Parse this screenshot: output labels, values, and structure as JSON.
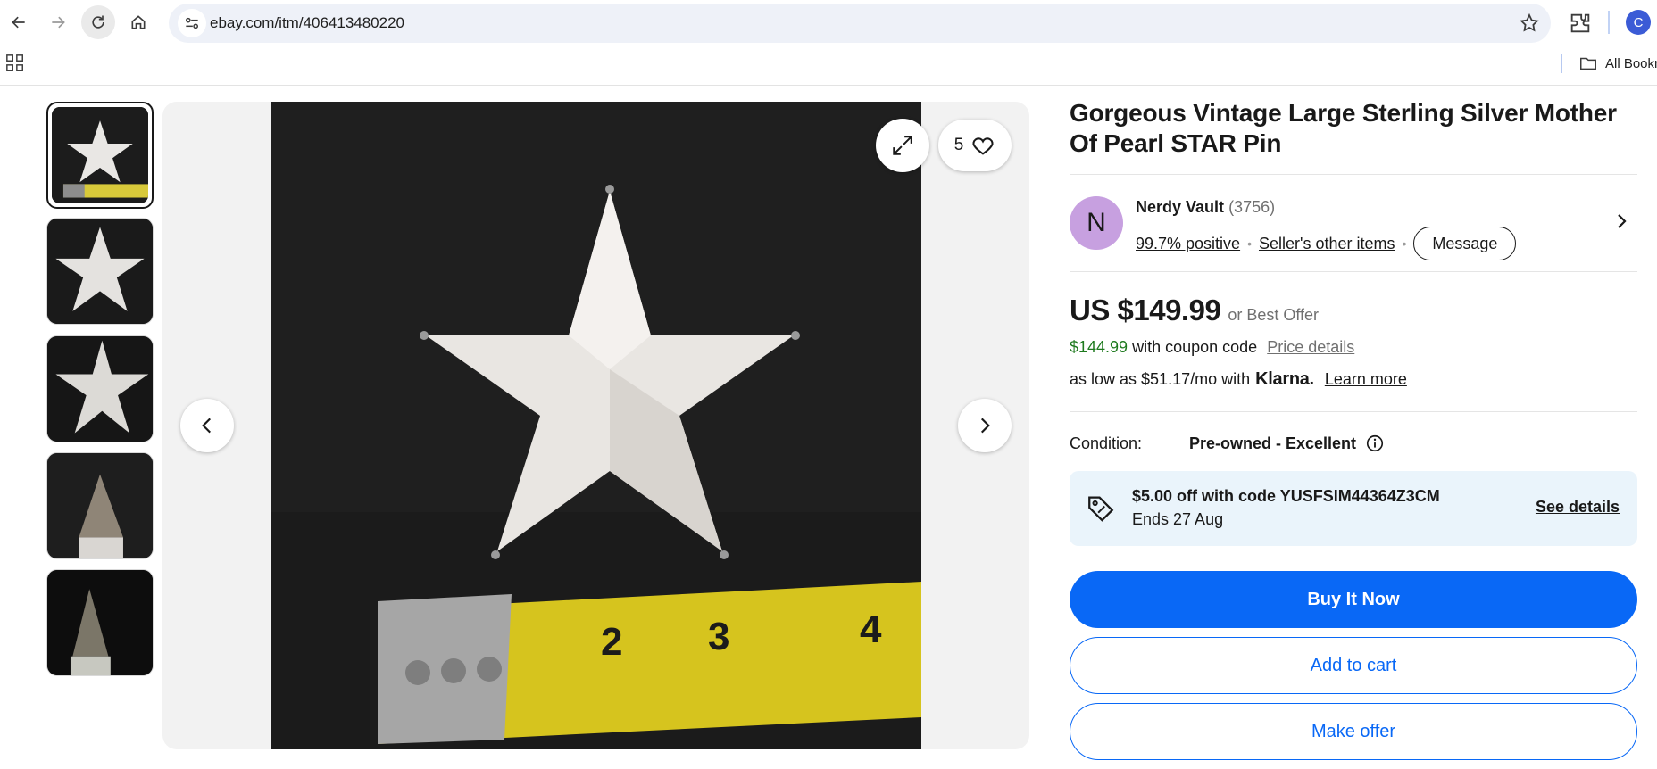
{
  "browser": {
    "url": "ebay.com/itm/406413480220",
    "bookmarks_label": "All Bookmarks",
    "profile_initial": "C"
  },
  "gallery": {
    "thumbnails": [
      "Star front with tape",
      "Star front",
      "Star angle",
      "Star point close-up",
      "Star point detail"
    ],
    "watch_count": "5"
  },
  "listing": {
    "title": "Gorgeous Vintage Large Sterling Silver Mother Of Pearl STAR Pin",
    "seller": {
      "avatar_initial": "N",
      "name": "Nerdy Vault",
      "feedback_count": "(3756)",
      "positive": "99.7% positive",
      "other_items": "Seller's other items",
      "message_label": "Message"
    },
    "price": "US $149.99",
    "best_offer": "or Best Offer",
    "coupon_price": "$144.99",
    "coupon_text": "with coupon code",
    "price_details": "Price details",
    "klarna_text": "as low as $51.17/mo with",
    "klarna_brand": "Klarna.",
    "learn_more": "Learn more",
    "condition_label": "Condition:",
    "condition_value": "Pre-owned - Excellent",
    "promo": {
      "title": "$5.00 off with code YUSFSIM44364Z3CM",
      "ends": "Ends 27 Aug",
      "see_details": "See details"
    },
    "buttons": {
      "buy_now": "Buy It Now",
      "add_to_cart": "Add to cart",
      "make_offer": "Make offer"
    }
  },
  "colors": {
    "primary_blue": "#0968f6",
    "promo_bg": "#eaf4fb",
    "coupon_green": "#1f7a1f",
    "avatar_purple": "#c7a0e0"
  }
}
